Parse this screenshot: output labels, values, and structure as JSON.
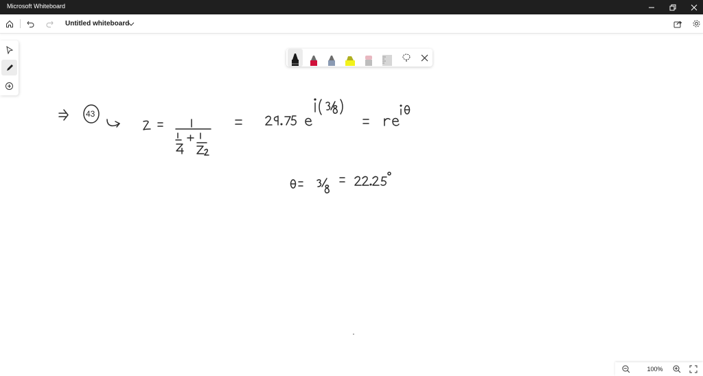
{
  "window": {
    "app_title": "Microsoft Whiteboard"
  },
  "toolbar": {
    "board_title": "Untitled whiteboard"
  },
  "icons": {
    "home": "home-icon",
    "undo": "undo-icon",
    "redo": "redo-icon",
    "dropdown": "chevron-down-icon",
    "share": "share-icon",
    "settings": "gear-icon",
    "minimize": "minimize-icon",
    "restore": "restore-icon",
    "close": "close-icon"
  },
  "sidebar": {
    "items": [
      "select-icon",
      "pen-icon",
      "add-icon"
    ]
  },
  "pen_tray": {
    "pens": [
      {
        "name": "black-pen",
        "color": "#1a1a1a"
      },
      {
        "name": "red-pen",
        "color": "#d0103a"
      },
      {
        "name": "blue-pen",
        "color": "#8a9ab3"
      },
      {
        "name": "yellow-highlighter",
        "color": "#f2f21b"
      },
      {
        "name": "eraser",
        "color": "#e8b7c0"
      },
      {
        "name": "ruler",
        "color": "#c8c8c8"
      }
    ]
  },
  "canvas": {
    "ink": {
      "problem_number": "43",
      "line1": [
        "⇒",
        "z =",
        "1",
        "1",
        "Z",
        "1",
        "+",
        "1",
        "Z",
        "2",
        "=",
        "29.75",
        "e",
        "i",
        "(",
        "3",
        "8",
        ")",
        "=",
        "r",
        "e",
        "i",
        "θ"
      ],
      "line2": [
        "θ =",
        "3",
        "8",
        "=",
        "22.25",
        "°"
      ]
    }
  },
  "zoom": {
    "value": "100%"
  },
  "colors": {
    "titlebar_bg": "#1f1f1f",
    "ink": "#2a2a2a"
  }
}
